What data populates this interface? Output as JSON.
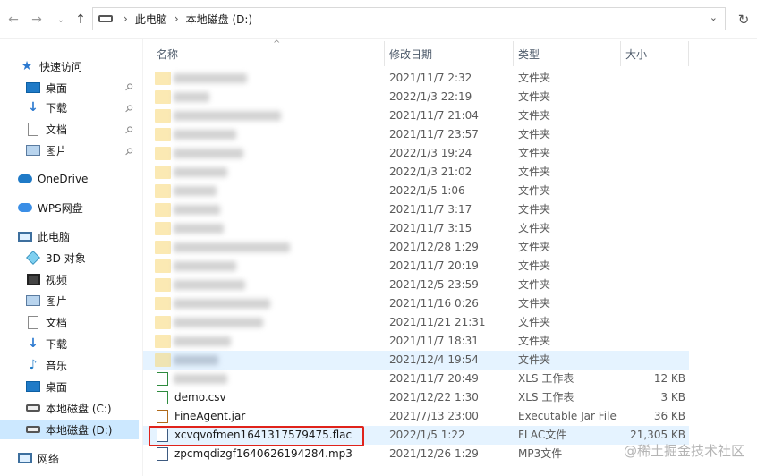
{
  "address": {
    "segments": [
      "此电脑",
      "本地磁盘 (D:)"
    ]
  },
  "sidebar": {
    "items": [
      {
        "label": "快速访问",
        "icon": "star-icon"
      },
      {
        "label": "桌面",
        "icon": "desktop-icon"
      },
      {
        "label": "下载",
        "icon": "download-icon"
      },
      {
        "label": "文档",
        "icon": "document-icon"
      },
      {
        "label": "图片",
        "icon": "picture-icon"
      },
      {
        "label": "OneDrive",
        "icon": "cloud-icon"
      },
      {
        "label": "WPS网盘",
        "icon": "cloud-icon"
      },
      {
        "label": "此电脑",
        "icon": "computer-icon"
      },
      {
        "label": "3D 对象",
        "icon": "cube-icon"
      },
      {
        "label": "视频",
        "icon": "video-icon"
      },
      {
        "label": "图片",
        "icon": "picture-icon"
      },
      {
        "label": "文档",
        "icon": "document-icon"
      },
      {
        "label": "下载",
        "icon": "download-icon"
      },
      {
        "label": "音乐",
        "icon": "music-icon"
      },
      {
        "label": "桌面",
        "icon": "desktop-icon"
      },
      {
        "label": "本地磁盘 (C:)",
        "icon": "drive-icon"
      },
      {
        "label": "本地磁盘 (D:)",
        "icon": "drive-icon"
      },
      {
        "label": "网络",
        "icon": "network-icon"
      }
    ]
  },
  "columns": [
    "名称",
    "修改日期",
    "类型",
    "大小"
  ],
  "rows": [
    {
      "name": "",
      "date": "2021/11/7 2:32",
      "type": "文件夹",
      "size": ""
    },
    {
      "name": "",
      "date": "2022/1/3 22:19",
      "type": "文件夹",
      "size": ""
    },
    {
      "name": "",
      "date": "2021/11/7 21:04",
      "type": "文件夹",
      "size": ""
    },
    {
      "name": "",
      "date": "2021/11/7 23:57",
      "type": "文件夹",
      "size": ""
    },
    {
      "name": "",
      "date": "2022/1/3 19:24",
      "type": "文件夹",
      "size": ""
    },
    {
      "name": "",
      "date": "2022/1/3 21:02",
      "type": "文件夹",
      "size": ""
    },
    {
      "name": "",
      "date": "2022/1/5 1:06",
      "type": "文件夹",
      "size": ""
    },
    {
      "name": "",
      "date": "2021/11/7 3:17",
      "type": "文件夹",
      "size": ""
    },
    {
      "name": "",
      "date": "2021/11/7 3:15",
      "type": "文件夹",
      "size": ""
    },
    {
      "name": "",
      "date": "2021/12/28 1:29",
      "type": "文件夹",
      "size": ""
    },
    {
      "name": "",
      "date": "2021/11/7 20:19",
      "type": "文件夹",
      "size": ""
    },
    {
      "name": "",
      "date": "2021/12/5 23:59",
      "type": "文件夹",
      "size": ""
    },
    {
      "name": "",
      "date": "2021/11/16 0:26",
      "type": "文件夹",
      "size": ""
    },
    {
      "name": "",
      "date": "2021/11/21 21:31",
      "type": "文件夹",
      "size": ""
    },
    {
      "name": "",
      "date": "2021/11/7 18:31",
      "type": "文件夹",
      "size": ""
    },
    {
      "name": "",
      "date": "2021/12/4 19:54",
      "type": "文件夹",
      "size": ""
    },
    {
      "name": "",
      "date": "2021/11/7 20:49",
      "type": "XLS 工作表",
      "size": "12 KB"
    },
    {
      "name": "demo.csv",
      "date": "2021/12/22 1:30",
      "type": "XLS 工作表",
      "size": "3 KB"
    },
    {
      "name": "FineAgent.jar",
      "date": "2021/7/13 23:00",
      "type": "Executable Jar File",
      "size": "36 KB"
    },
    {
      "name": "xcvqvofmen1641317579475.flac",
      "date": "2022/1/5 1:22",
      "type": "FLAC文件",
      "size": "21,305 KB"
    },
    {
      "name": "zpcmqdizgf1640626194284.mp3",
      "date": "2021/12/26 1:29",
      "type": "MP3文件",
      "size": ""
    }
  ],
  "watermark": "@稀土掘金技术社区"
}
